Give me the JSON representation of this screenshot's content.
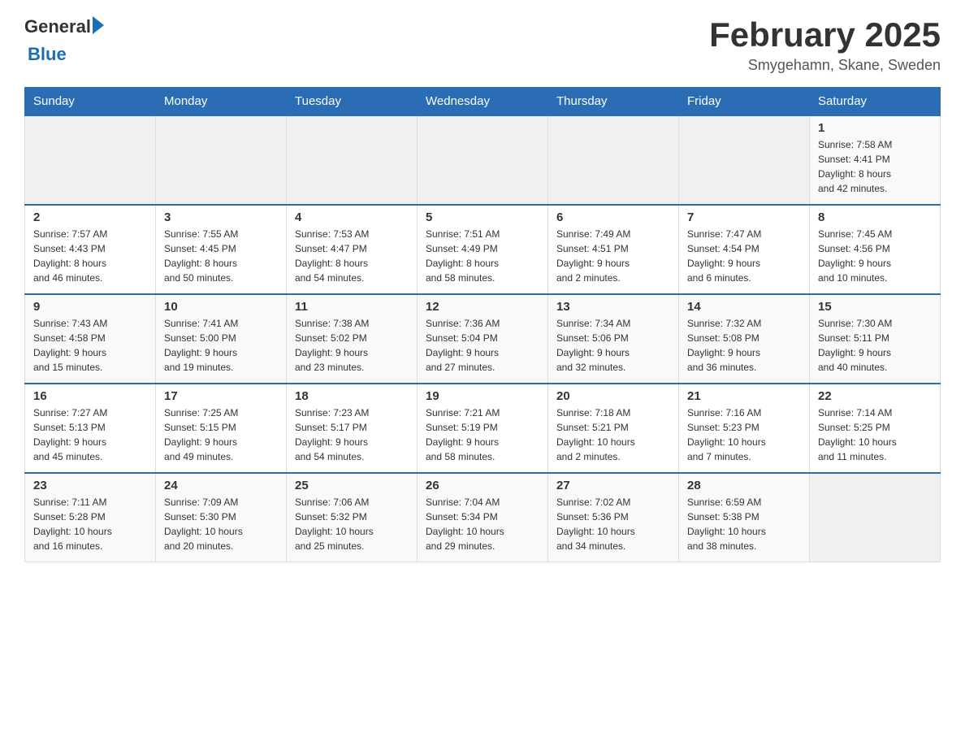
{
  "header": {
    "logo": {
      "general": "General",
      "blue": "Blue"
    },
    "title": "February 2025",
    "location": "Smygehamn, Skane, Sweden"
  },
  "days_of_week": [
    "Sunday",
    "Monday",
    "Tuesday",
    "Wednesday",
    "Thursday",
    "Friday",
    "Saturday"
  ],
  "weeks": [
    {
      "days": [
        {
          "number": "",
          "info": ""
        },
        {
          "number": "",
          "info": ""
        },
        {
          "number": "",
          "info": ""
        },
        {
          "number": "",
          "info": ""
        },
        {
          "number": "",
          "info": ""
        },
        {
          "number": "",
          "info": ""
        },
        {
          "number": "1",
          "info": "Sunrise: 7:58 AM\nSunset: 4:41 PM\nDaylight: 8 hours\nand 42 minutes."
        }
      ]
    },
    {
      "days": [
        {
          "number": "2",
          "info": "Sunrise: 7:57 AM\nSunset: 4:43 PM\nDaylight: 8 hours\nand 46 minutes."
        },
        {
          "number": "3",
          "info": "Sunrise: 7:55 AM\nSunset: 4:45 PM\nDaylight: 8 hours\nand 50 minutes."
        },
        {
          "number": "4",
          "info": "Sunrise: 7:53 AM\nSunset: 4:47 PM\nDaylight: 8 hours\nand 54 minutes."
        },
        {
          "number": "5",
          "info": "Sunrise: 7:51 AM\nSunset: 4:49 PM\nDaylight: 8 hours\nand 58 minutes."
        },
        {
          "number": "6",
          "info": "Sunrise: 7:49 AM\nSunset: 4:51 PM\nDaylight: 9 hours\nand 2 minutes."
        },
        {
          "number": "7",
          "info": "Sunrise: 7:47 AM\nSunset: 4:54 PM\nDaylight: 9 hours\nand 6 minutes."
        },
        {
          "number": "8",
          "info": "Sunrise: 7:45 AM\nSunset: 4:56 PM\nDaylight: 9 hours\nand 10 minutes."
        }
      ]
    },
    {
      "days": [
        {
          "number": "9",
          "info": "Sunrise: 7:43 AM\nSunset: 4:58 PM\nDaylight: 9 hours\nand 15 minutes."
        },
        {
          "number": "10",
          "info": "Sunrise: 7:41 AM\nSunset: 5:00 PM\nDaylight: 9 hours\nand 19 minutes."
        },
        {
          "number": "11",
          "info": "Sunrise: 7:38 AM\nSunset: 5:02 PM\nDaylight: 9 hours\nand 23 minutes."
        },
        {
          "number": "12",
          "info": "Sunrise: 7:36 AM\nSunset: 5:04 PM\nDaylight: 9 hours\nand 27 minutes."
        },
        {
          "number": "13",
          "info": "Sunrise: 7:34 AM\nSunset: 5:06 PM\nDaylight: 9 hours\nand 32 minutes."
        },
        {
          "number": "14",
          "info": "Sunrise: 7:32 AM\nSunset: 5:08 PM\nDaylight: 9 hours\nand 36 minutes."
        },
        {
          "number": "15",
          "info": "Sunrise: 7:30 AM\nSunset: 5:11 PM\nDaylight: 9 hours\nand 40 minutes."
        }
      ]
    },
    {
      "days": [
        {
          "number": "16",
          "info": "Sunrise: 7:27 AM\nSunset: 5:13 PM\nDaylight: 9 hours\nand 45 minutes."
        },
        {
          "number": "17",
          "info": "Sunrise: 7:25 AM\nSunset: 5:15 PM\nDaylight: 9 hours\nand 49 minutes."
        },
        {
          "number": "18",
          "info": "Sunrise: 7:23 AM\nSunset: 5:17 PM\nDaylight: 9 hours\nand 54 minutes."
        },
        {
          "number": "19",
          "info": "Sunrise: 7:21 AM\nSunset: 5:19 PM\nDaylight: 9 hours\nand 58 minutes."
        },
        {
          "number": "20",
          "info": "Sunrise: 7:18 AM\nSunset: 5:21 PM\nDaylight: 10 hours\nand 2 minutes."
        },
        {
          "number": "21",
          "info": "Sunrise: 7:16 AM\nSunset: 5:23 PM\nDaylight: 10 hours\nand 7 minutes."
        },
        {
          "number": "22",
          "info": "Sunrise: 7:14 AM\nSunset: 5:25 PM\nDaylight: 10 hours\nand 11 minutes."
        }
      ]
    },
    {
      "days": [
        {
          "number": "23",
          "info": "Sunrise: 7:11 AM\nSunset: 5:28 PM\nDaylight: 10 hours\nand 16 minutes."
        },
        {
          "number": "24",
          "info": "Sunrise: 7:09 AM\nSunset: 5:30 PM\nDaylight: 10 hours\nand 20 minutes."
        },
        {
          "number": "25",
          "info": "Sunrise: 7:06 AM\nSunset: 5:32 PM\nDaylight: 10 hours\nand 25 minutes."
        },
        {
          "number": "26",
          "info": "Sunrise: 7:04 AM\nSunset: 5:34 PM\nDaylight: 10 hours\nand 29 minutes."
        },
        {
          "number": "27",
          "info": "Sunrise: 7:02 AM\nSunset: 5:36 PM\nDaylight: 10 hours\nand 34 minutes."
        },
        {
          "number": "28",
          "info": "Sunrise: 6:59 AM\nSunset: 5:38 PM\nDaylight: 10 hours\nand 38 minutes."
        },
        {
          "number": "",
          "info": ""
        }
      ]
    }
  ]
}
